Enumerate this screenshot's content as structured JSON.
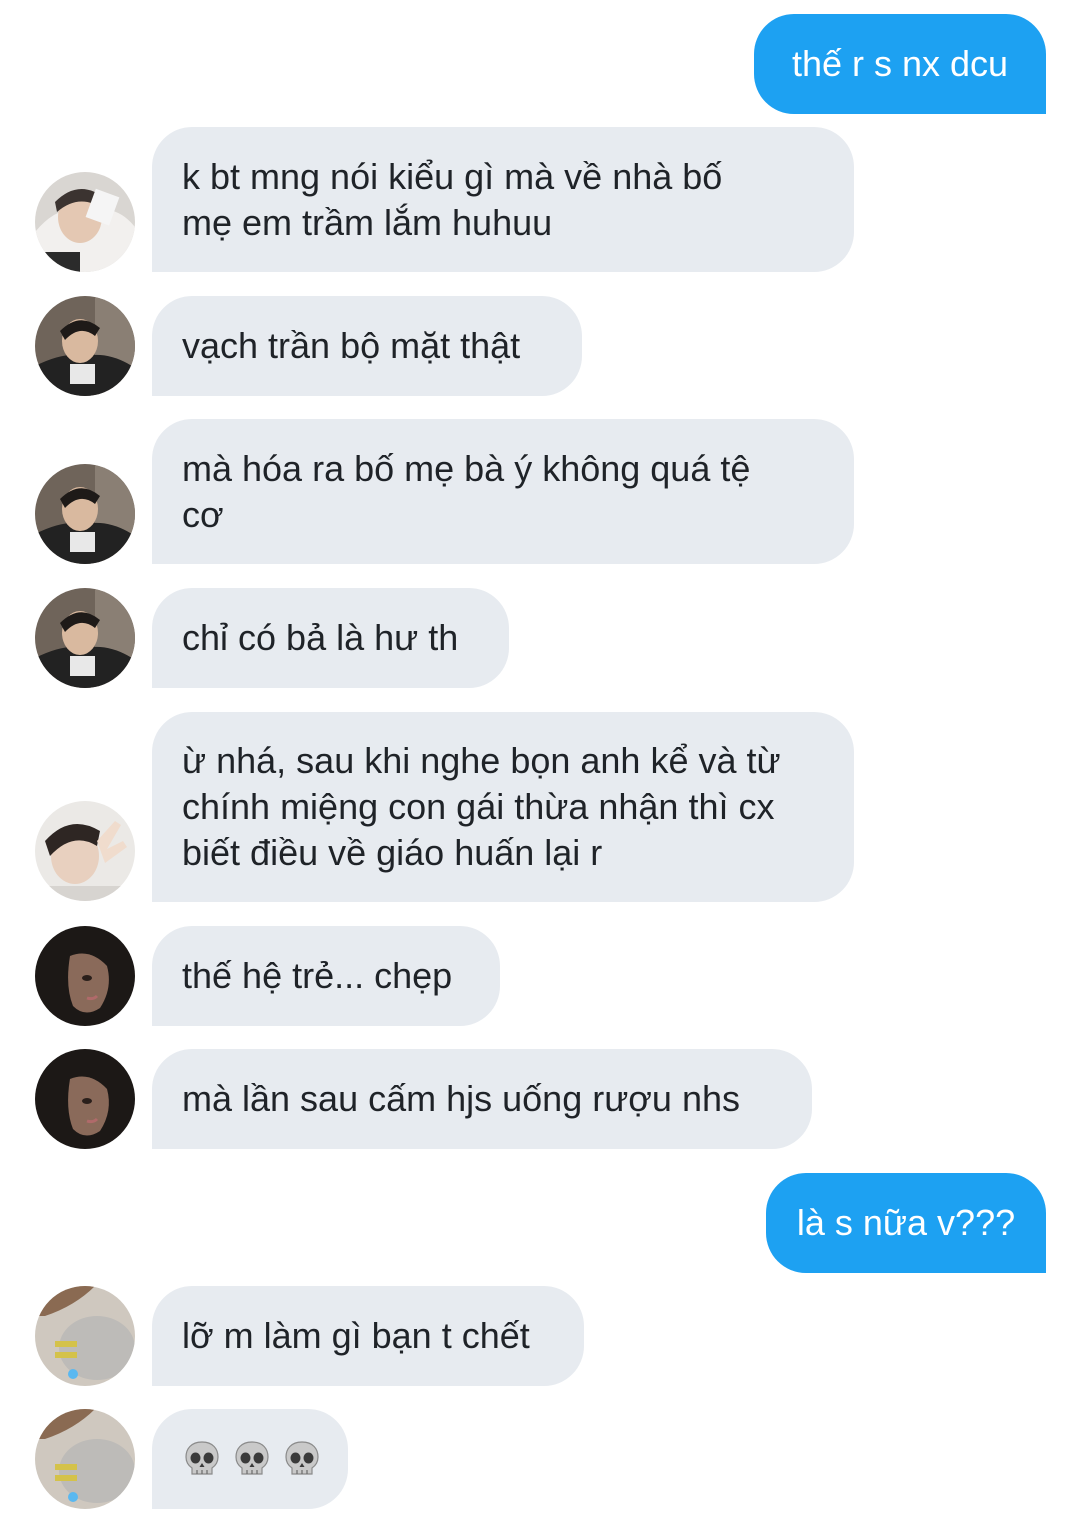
{
  "messages": [
    {
      "side": "out",
      "text": "thế r s nx dcu"
    },
    {
      "side": "in",
      "avatar": "avatar-hoodie",
      "text": "k bt mng nói kiểu gì mà về nhà bố\nmẹ em trầm lắm huhuu"
    },
    {
      "side": "in",
      "avatar": "avatar-jacket",
      "text": "vạch trần bộ mặt thật"
    },
    {
      "side": "in",
      "avatar": "avatar-jacket",
      "text": "mà hóa ra bố mẹ bà ý không quá tệ\ncơ"
    },
    {
      "side": "in",
      "avatar": "avatar-jacket",
      "text": "chỉ có bả là hư th"
    },
    {
      "side": "in",
      "avatar": "avatar-peace",
      "text": "ừ nhá, sau khi nghe bọn anh kể và từ\nchính miệng con gái thừa nhận thì cx\nbiết điều về giáo huấn lại r"
    },
    {
      "side": "in",
      "avatar": "avatar-dark",
      "text": "thế hệ trẻ... chẹp"
    },
    {
      "side": "in",
      "avatar": "avatar-dark",
      "text": "mà lần sau cấm hjs uống rượu nhs"
    },
    {
      "side": "out",
      "text": "là s nữa v???"
    },
    {
      "side": "in",
      "avatar": "avatar-plush",
      "text": "lỡ m làm gì bạn t chết"
    },
    {
      "side": "in",
      "avatar": "avatar-plush",
      "emoji": [
        "skull",
        "skull",
        "skull"
      ]
    }
  ],
  "colors": {
    "outgoing": "#1da1f2",
    "incoming": "#e7ebf0"
  }
}
